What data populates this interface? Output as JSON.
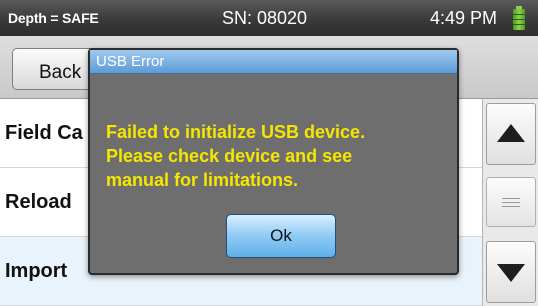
{
  "status_bar": {
    "depth_status": "Depth = SAFE",
    "serial": "SN: 08020",
    "time": "4:49 PM",
    "battery_icon": "battery-icon",
    "battery_color": "#8fd14f"
  },
  "toolbar": {
    "back_label": "Back"
  },
  "list": {
    "items": [
      {
        "label": "Field Ca"
      },
      {
        "label": "Reload"
      },
      {
        "label": "Import"
      }
    ]
  },
  "scroll": {
    "up_icon": "chevron-up-icon",
    "down_icon": "chevron-down-icon"
  },
  "dialog": {
    "title": "USB Error",
    "message_lines": [
      "Failed to initialize USB device.",
      "Please check device and see",
      "manual for limitations."
    ],
    "ok_label": "Ok",
    "message_color": "#f6e600",
    "title_color": "#5d9ad6"
  }
}
